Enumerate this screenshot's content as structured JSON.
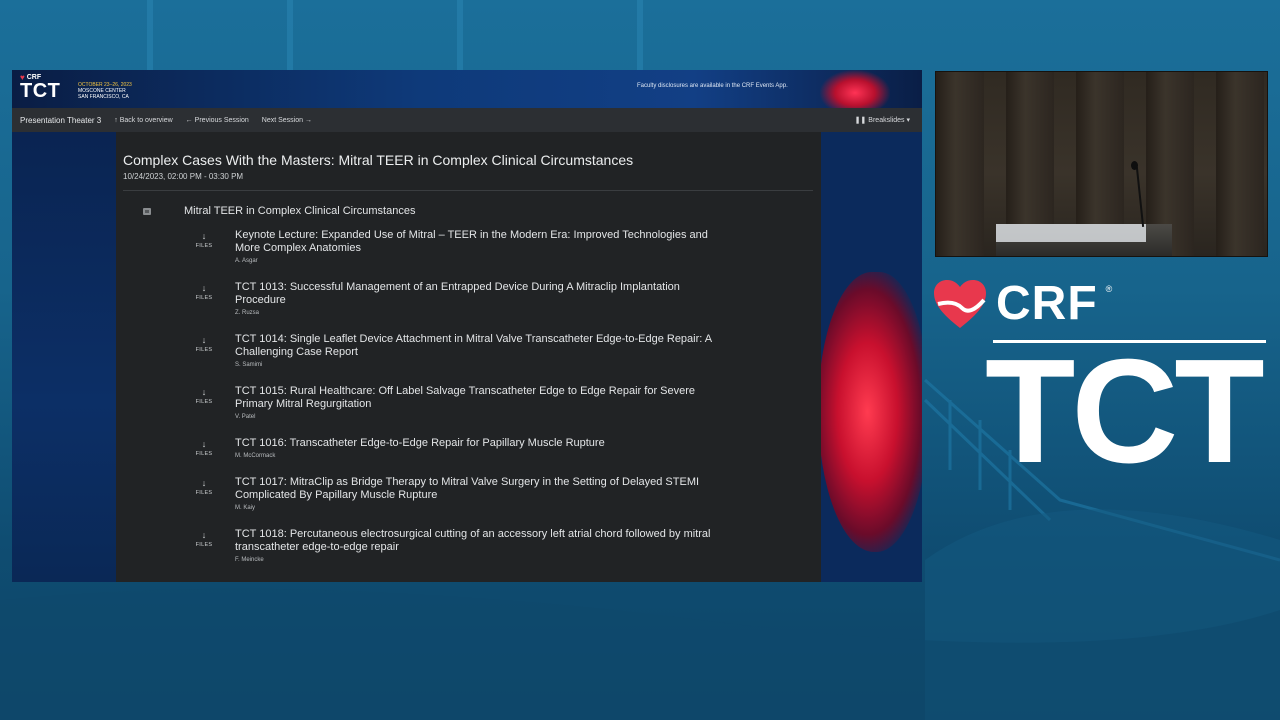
{
  "banner": {
    "crf_label": "CRF",
    "tct_label": "TCT",
    "event_dates": "OCTOBER 23–26, 2023",
    "venue_line1": "MOSCONE CENTER",
    "venue_line2": "SAN FRANCISCO, CA",
    "disclosure_text": "Faculty disclosures are available in the CRF Events App."
  },
  "navbar": {
    "venue": "Presentation Theater 3",
    "back_label": "Back to overview",
    "prev_label": "Previous Session",
    "next_label": "Next Session",
    "breakslides_label": "Breakslides"
  },
  "session": {
    "title": "Complex Cases With the Masters: Mitral TEER in Complex Clinical Circumstances",
    "datetime": "10/24/2023, 02:00 PM - 03:30 PM",
    "track_title": "Mitral TEER in Complex Clinical Circumstances",
    "files_label": "FILES",
    "talks": [
      {
        "title": "Keynote Lecture: Expanded Use of Mitral – TEER in the Modern Era: Improved Technologies and More Complex Anatomies",
        "author": "A. Asgar"
      },
      {
        "title": "TCT 1013: Successful Management of an Entrapped Device During A Mitraclip Implantation Procedure",
        "author": "Z. Ruzsa"
      },
      {
        "title": "TCT 1014: Single Leaflet Device Attachment in Mitral Valve Transcatheter Edge-to-Edge Repair: A Challenging Case Report",
        "author": "S. Samimi"
      },
      {
        "title": "TCT 1015: Rural Healthcare: Off Label Salvage Transcatheter Edge to Edge Repair for Severe Primary Mitral Regurgitation",
        "author": "V. Patel"
      },
      {
        "title": "TCT 1016: Transcatheter Edge-to-Edge Repair for Papillary Muscle Rupture",
        "author": "M. McCormack"
      },
      {
        "title": "TCT 1017: MitraClip as Bridge Therapy to Mitral Valve Surgery in the Setting of Delayed STEMI Complicated By Papillary Muscle Rupture",
        "author": "M. Kaiy"
      },
      {
        "title": "TCT 1018: Percutaneous electrosurgical cutting of an accessory left atrial chord followed by  mitral transcatheter edge-to-edge repair",
        "author": "F. Meincke"
      }
    ]
  },
  "brand": {
    "crf": "CRF",
    "registered": "®",
    "tct": "TCT"
  },
  "colors": {
    "background": "#17648c",
    "panel": "#212325",
    "navbar": "#2c2f33",
    "accent_red": "#e8384d"
  }
}
